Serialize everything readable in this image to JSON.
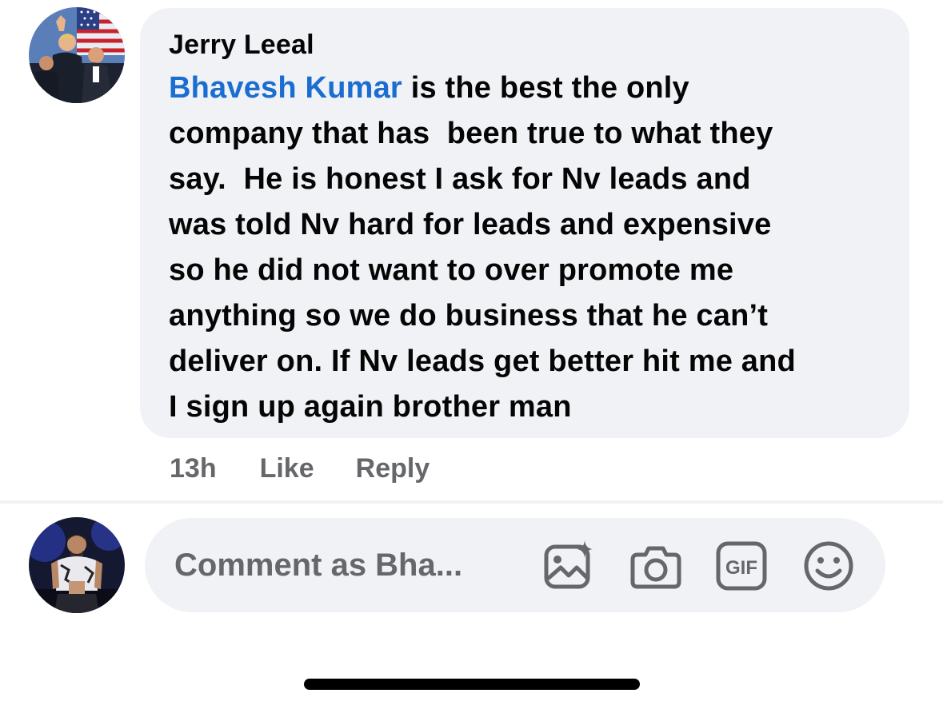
{
  "comment": {
    "author": "Jerry Leeal",
    "mention": "Bhavesh Kumar",
    "lines": [
      " is the best the only",
      "company that has  been true to what they",
      "say.  He is honest I ask for Nv leads and",
      "was told Nv hard for leads and expensive",
      "so he did not want to over promote me",
      "anything so we do business that he can’t",
      "deliver on. If Nv leads get better hit me and",
      "I sign up again brother man"
    ],
    "timestamp": "13h",
    "like_label": "Like",
    "reply_label": "Reply"
  },
  "composer": {
    "placeholder": "Comment as Bha...",
    "icons": [
      "add-photo-icon",
      "camera-icon",
      "gif-icon",
      "emoji-icon"
    ],
    "gif_label": "GIF"
  },
  "colors": {
    "bubble_bg": "#f0f2f5",
    "mention": "#1b6ed1",
    "text": "#050505",
    "secondary_text": "#65676b",
    "icon": "#65676b"
  }
}
